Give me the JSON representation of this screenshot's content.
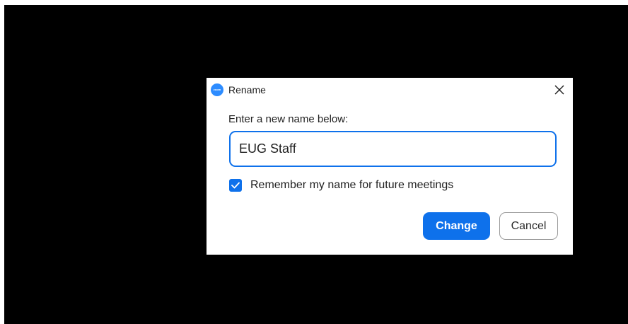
{
  "dialog": {
    "title": "Rename",
    "app_icon_text": "zoom",
    "close_icon": "close-icon",
    "prompt": "Enter a new name below:",
    "name_value": "EUG Staff",
    "remember_checked": true,
    "remember_label": "Remember my name for future meetings",
    "change_label": "Change",
    "cancel_label": "Cancel"
  },
  "colors": {
    "accent": "#0e71eb",
    "brand": "#2d8cff",
    "background": "#000000"
  }
}
